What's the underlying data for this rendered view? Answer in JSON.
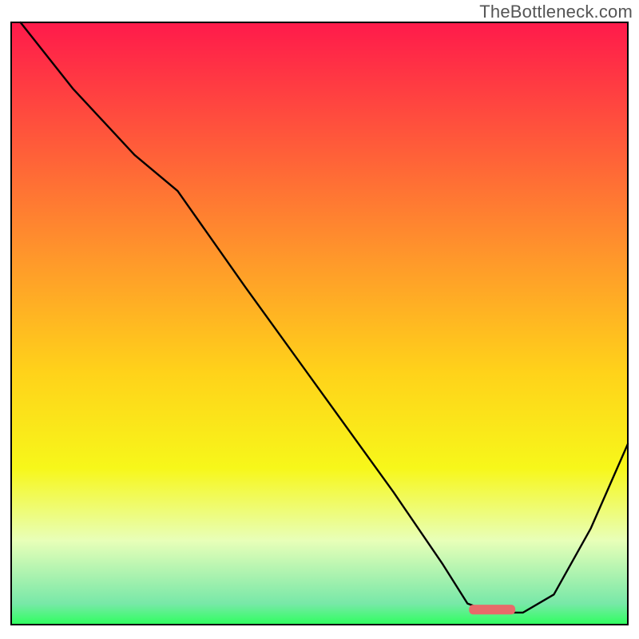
{
  "watermark": "TheBottleneck.com",
  "chart_data": {
    "type": "line",
    "title": "",
    "xlabel": "",
    "ylabel": "",
    "xlim": [
      0,
      100
    ],
    "ylim": [
      0,
      100
    ],
    "grid": false,
    "legend": false,
    "axes_visible": false,
    "background": {
      "type": "vertical_gradient",
      "stops": [
        {
          "offset": 0.0,
          "color": "#ff1a4b"
        },
        {
          "offset": 0.2,
          "color": "#ff5a3a"
        },
        {
          "offset": 0.4,
          "color": "#ff9a2a"
        },
        {
          "offset": 0.58,
          "color": "#ffd21a"
        },
        {
          "offset": 0.74,
          "color": "#f7f71a"
        },
        {
          "offset": 0.86,
          "color": "#e8ffb8"
        },
        {
          "offset": 0.965,
          "color": "#78e8a8"
        },
        {
          "offset": 1.0,
          "color": "#2eff5e"
        }
      ]
    },
    "series": [
      {
        "name": "bottleneck-curve",
        "stroke": "#000000",
        "stroke_width": 2.4,
        "x": [
          1.5,
          10,
          20,
          27,
          38,
          50,
          62,
          70,
          74,
          78,
          83,
          88,
          94,
          100
        ],
        "y": [
          100,
          89,
          78,
          72,
          56,
          39,
          22,
          10,
          3.5,
          2,
          2,
          5,
          16,
          30
        ]
      }
    ],
    "markers": [
      {
        "name": "target-segment",
        "shape": "rounded_rect",
        "fill": "#e76a6a",
        "x_center": 78,
        "y_center": 2.5,
        "width_pct": 7.5,
        "height_pct": 1.6
      }
    ]
  }
}
